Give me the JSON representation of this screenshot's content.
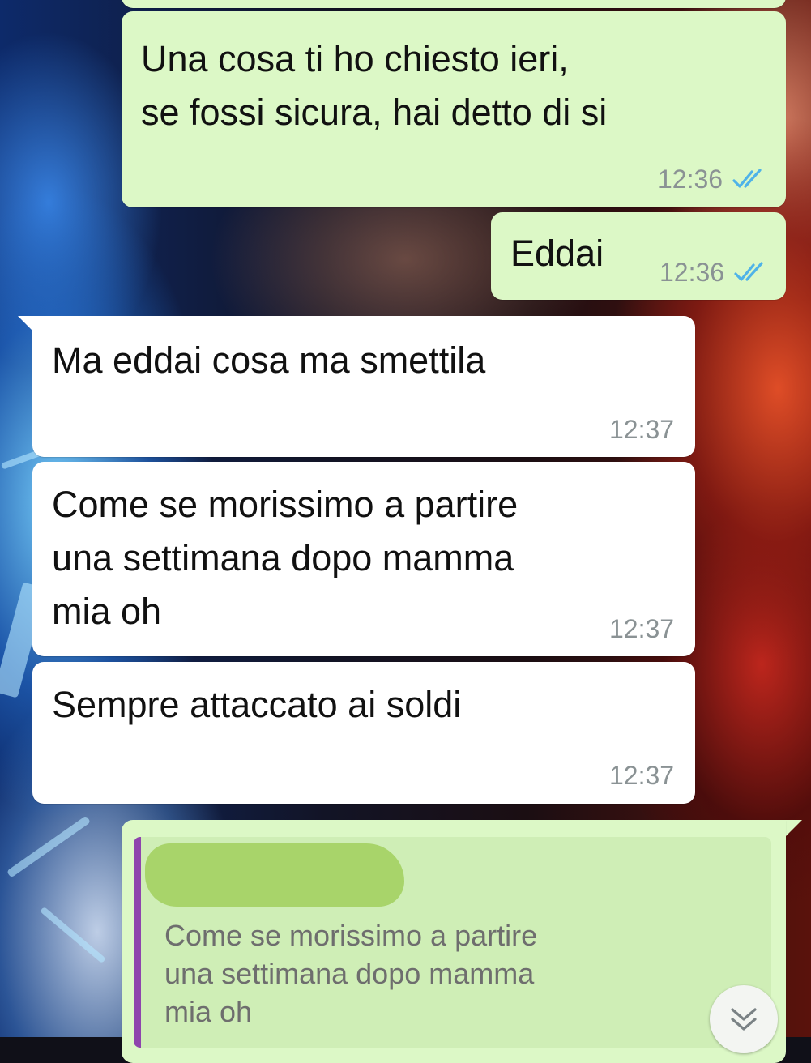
{
  "colors": {
    "outgoing_bubble": "#dcf8c6",
    "incoming_bubble": "#ffffff",
    "read_ticks": "#4fb3e8",
    "quote_bar": "#8e44ad",
    "timestamp": "#8a9294"
  },
  "messages": [
    {
      "direction": "outgoing",
      "text": "Una cosa ti ho chiesto ieri,\nse fossi sicura, hai detto di si",
      "time": "12:36",
      "status": "read",
      "status_icon": "double-check-icon"
    },
    {
      "direction": "outgoing",
      "text": "Eddai",
      "time": "12:36",
      "status": "read",
      "status_icon": "double-check-icon"
    },
    {
      "direction": "incoming",
      "text": "Ma eddai cosa ma smettila",
      "time": "12:37"
    },
    {
      "direction": "incoming",
      "text": "Come se morissimo a partire\nuna settimana dopo mamma\nmia oh",
      "time": "12:37"
    },
    {
      "direction": "incoming",
      "text": "Sempre attaccato ai soldi",
      "time": "12:37"
    }
  ],
  "reply": {
    "quoted_author": "",
    "quoted_text": "Come se morissimo a partire\nuna settimana dopo mamma\nmia oh"
  },
  "scroll_button": {
    "icon": "chevron-double-down-icon"
  }
}
